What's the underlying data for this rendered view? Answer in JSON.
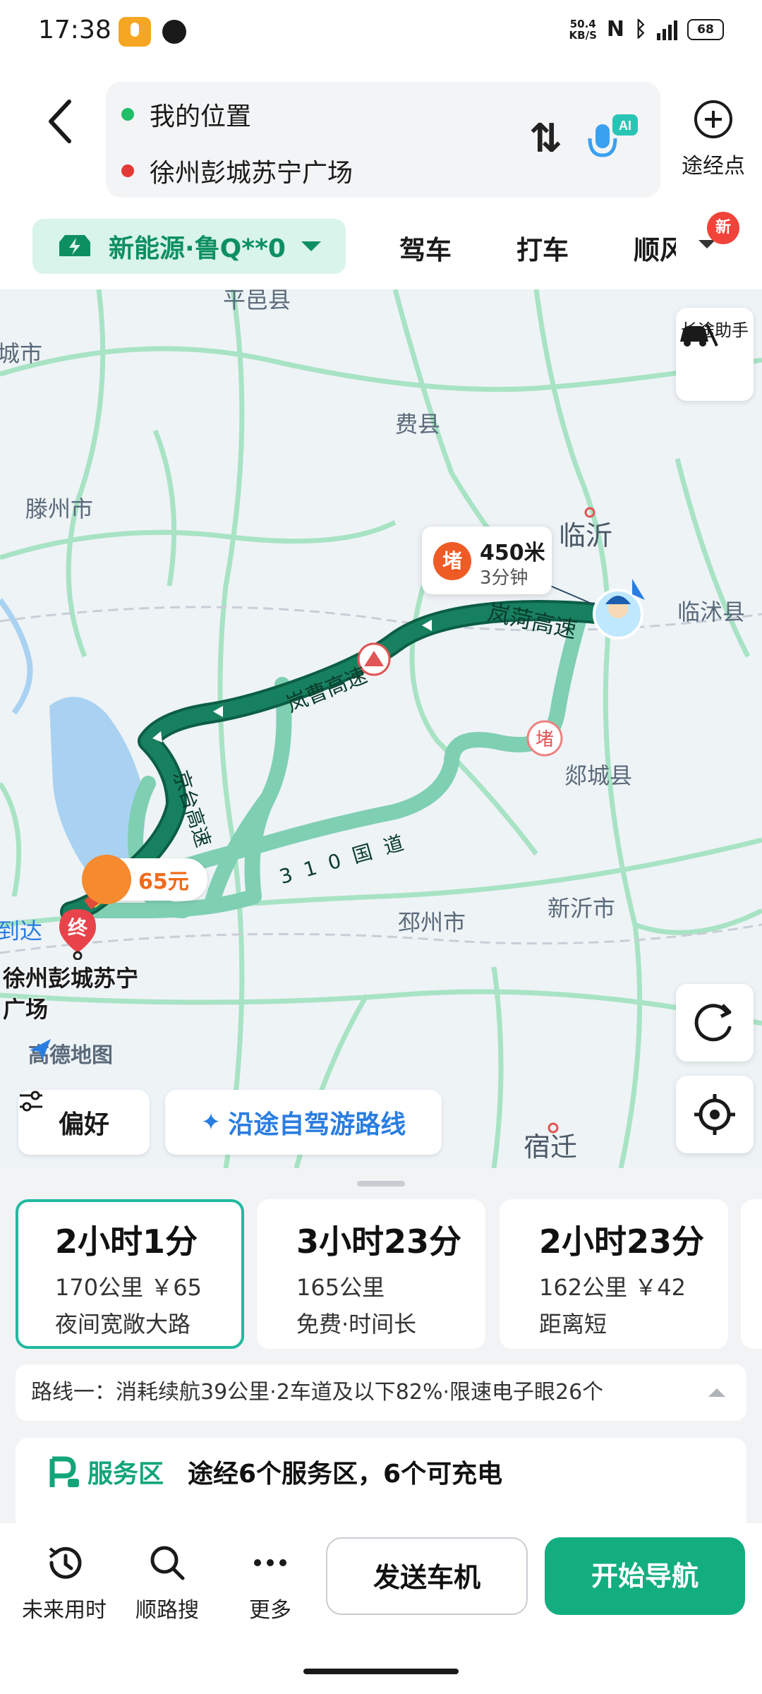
{
  "status_bar": {
    "time": "17:38",
    "net_speed_value": "50.4",
    "net_speed_unit": "KB/S",
    "battery": "68",
    "icons": [
      "mic-icon",
      "chat-bubble-icon",
      "nfc-icon",
      "bluetooth-icon",
      "signal-5g-icon",
      "battery-icon"
    ]
  },
  "header": {
    "origin": "我的位置",
    "destination": "徐州彭城苏宁广场",
    "waypoint_label": "途经点",
    "ai_badge": "AI"
  },
  "mode_tabs": {
    "ev_chip": "新能源·鲁Q**0",
    "drive": "驾车",
    "taxi": "打车",
    "ride": "顺风车",
    "new_badge": "新"
  },
  "map": {
    "labels": {
      "pingyi": "平邑县",
      "xiaocheng": "城市",
      "feixian": "费县",
      "tengzhou": "滕州市",
      "linyi": "临沂",
      "linshu": "临沭县",
      "tancheng": "郯城县",
      "pizhou": "邳州市",
      "xinyi": "新沂市",
      "suqian": "宿迁",
      "daoda": "到达",
      "highway1": "岚菏高速",
      "highway2": "岚曹高速",
      "highway3": "京台高速",
      "road310": "310国道"
    },
    "long_trip_assistant": "长途助手",
    "jam": {
      "badge": "堵",
      "distance": "450米",
      "time": "3分钟"
    },
    "alt_jam_badge": "堵",
    "toll": "65元",
    "end_badge": "终",
    "dest_label_line1": "徐州彭城苏宁",
    "dest_label_line2": "广场",
    "logo": "高德地图",
    "pref_btn": "偏好",
    "trip_btn": "沿途自驾游路线"
  },
  "routes": [
    {
      "time": "2小时1分",
      "info": "170公里 ￥65",
      "tag": "夜间宽敞大路",
      "selected": true
    },
    {
      "time": "3小时23分",
      "info": "165公里",
      "tag": "免费·时间长",
      "selected": false
    },
    {
      "time": "2小时23分",
      "info": "162公里 ￥42",
      "tag": "距离短",
      "selected": false
    }
  ],
  "route_summary": "路线一：消耗续航39公里·2车道及以下82%·限速电子眼26个",
  "service": {
    "label": "服务区",
    "desc": "途经6个服务区，6个可充电"
  },
  "bottom_bar": {
    "future_time": "未来用时",
    "along_search": "顺路搜",
    "more": "更多",
    "send_car": "发送车机",
    "start_nav": "开始导航"
  },
  "colors": {
    "brand_green": "#13ae80",
    "route_main": "#0f7d5a",
    "route_alt": "#7fcfb3",
    "jam_orange": "#ee5b25"
  }
}
